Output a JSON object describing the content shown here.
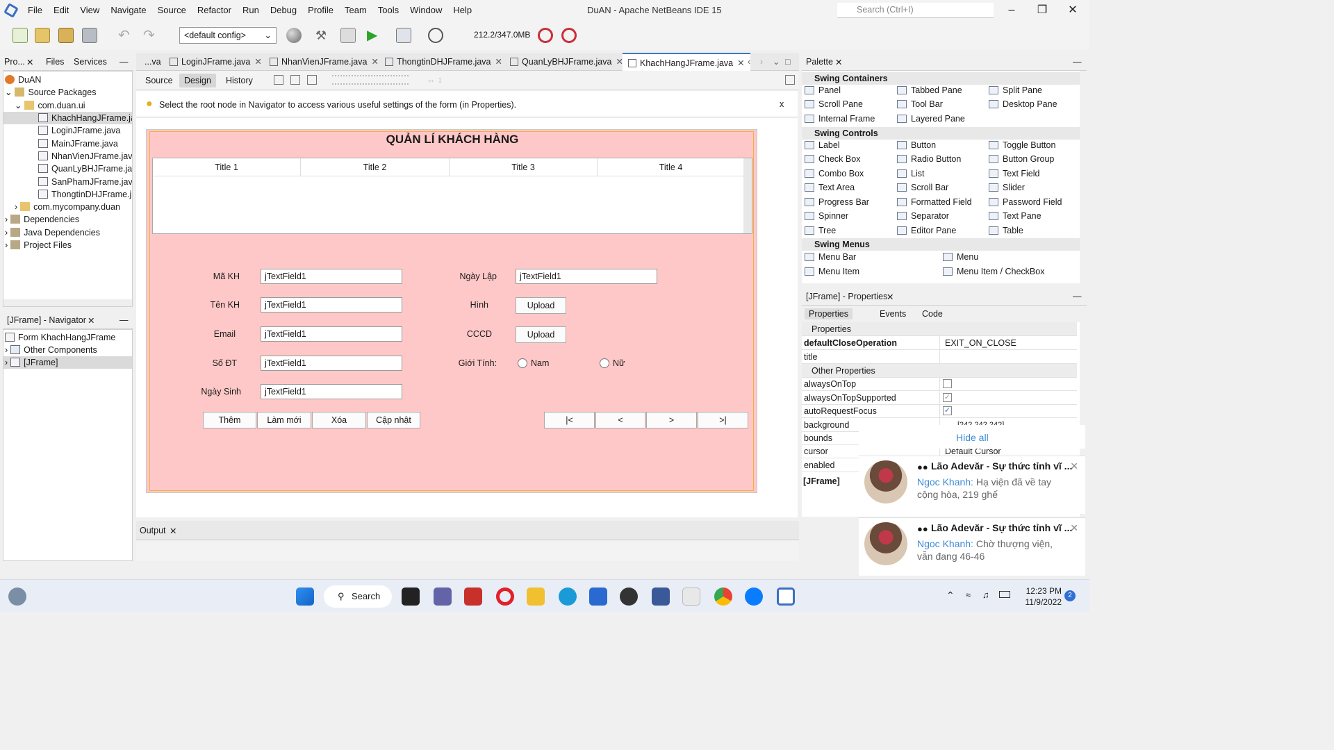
{
  "titlebar": {
    "menu": [
      "File",
      "Edit",
      "View",
      "Navigate",
      "Source",
      "Refactor",
      "Run",
      "Debug",
      "Profile",
      "Team",
      "Tools",
      "Window",
      "Help"
    ],
    "app_title": "DuAN - Apache NetBeans IDE 15",
    "search_placeholder": "Search (Ctrl+I)"
  },
  "toolbar": {
    "config": "<default config>",
    "memory": "212.2/347.0MB"
  },
  "projects": {
    "tabs": [
      "Pro...",
      "Files",
      "Services"
    ],
    "tree": [
      "DuAN",
      "Source Packages",
      "com.duan.ui",
      "KhachHangJFrame.java",
      "LoginJFrame.java",
      "MainJFrame.java",
      "NhanVienJFrame.java",
      "QuanLyBHJFrame.java",
      "SanPhamJFrame.java",
      "ThongtinDHJFrame.java",
      "com.mycompany.duan",
      "Dependencies",
      "Java Dependencies",
      "Project Files"
    ]
  },
  "navigator": {
    "title": "[JFrame] - Navigator",
    "tree": [
      "Form KhachHangJFrame",
      "Other Components",
      "[JFrame]"
    ]
  },
  "editor": {
    "tabs": [
      "...va",
      "LoginJFrame.java",
      "NhanVienJFrame.java",
      "ThongtinDHJFrame.java",
      "QuanLyBHJFrame.java",
      "KhachHangJFrame.java"
    ],
    "views": [
      "Source",
      "Design",
      "History"
    ],
    "hint": "Select the root node in Navigator to access various useful settings of the form (in Properties).",
    "hint_close": "x"
  },
  "form": {
    "title": "QUẢN LÍ KHÁCH HÀNG",
    "table_headers": [
      "Title 1",
      "Title 2",
      "Title 3",
      "Title 4"
    ],
    "labels": {
      "ma_kh": "Mã KH",
      "ten_kh": "Tên KH",
      "email": "Email",
      "so_dt": "Số ĐT",
      "ngay_sinh": "Ngày Sinh",
      "ngay_lap": "Ngày Lập",
      "hinh": "Hình",
      "cccd": "CCCD",
      "gioi_tinh": "Giới Tính:"
    },
    "field_value": "jTextField1",
    "upload": "Upload",
    "radio_nam": "Nam",
    "radio_nu": "Nữ",
    "actions": [
      "Thêm",
      "Làm mới",
      "Xóa",
      "Cập nhật"
    ],
    "nav": [
      "|<",
      "<",
      ">",
      ">|"
    ]
  },
  "output": {
    "tab": "Output"
  },
  "palette": {
    "title": "Palette",
    "containers_title": "Swing Containers",
    "containers": [
      "Panel",
      "Tabbed Pane",
      "Split Pane",
      "Scroll Pane",
      "Tool Bar",
      "Desktop Pane",
      "Internal Frame",
      "Layered Pane"
    ],
    "controls_title": "Swing Controls",
    "controls": [
      "Label",
      "Button",
      "Toggle Button",
      "Check Box",
      "Radio Button",
      "Button Group",
      "Combo Box",
      "List",
      "Text Field",
      "Text Area",
      "Scroll Bar",
      "Slider",
      "Progress Bar",
      "Formatted Field",
      "Password Field",
      "Spinner",
      "Separator",
      "Text Pane",
      "Tree",
      "Editor Pane",
      "Table"
    ],
    "menus_title": "Swing Menus",
    "menus": [
      "Menu Bar",
      "Menu",
      "Menu Item",
      "Menu Item / CheckBox"
    ]
  },
  "properties": {
    "title": "[JFrame] - Properties",
    "tabs": [
      "Properties",
      "Events",
      "Code"
    ],
    "section": "Properties",
    "other_section": "Other Properties",
    "default_close_key": "defaultCloseOperation",
    "default_close_val": "EXIT_ON_CLOSE",
    "title_key": "title",
    "rows": [
      "alwaysOnTop",
      "alwaysOnTopSupported",
      "autoRequestFocus",
      "background",
      "bounds",
      "cursor",
      "enabled"
    ],
    "background_val": "[242,242,242]",
    "cursor_val": "Default Cursor",
    "footer": "[JFrame]"
  },
  "notifications": {
    "hide_all": "Hide all",
    "items": [
      {
        "title": "Lão Adevăr - Sự thức tỉnh vĩ ...",
        "sender": "Ngoc Khanh:",
        "message": "Hạ viện đã về tay cộng hòa, 219 ghế"
      },
      {
        "title": "Lão Adevăr - Sự thức tỉnh vĩ ...",
        "sender": "Ngoc Khanh:",
        "message": "Chờ thượng viện, vẫn đang 46-46"
      }
    ]
  },
  "taskbar": {
    "search": "Search",
    "time": "12:23 PM",
    "date": "11/9/2022",
    "badge": "2"
  },
  "colors": {
    "form_bg": "#ffc8c8",
    "accent": "#3c78c0",
    "link": "#3a8ad6"
  }
}
